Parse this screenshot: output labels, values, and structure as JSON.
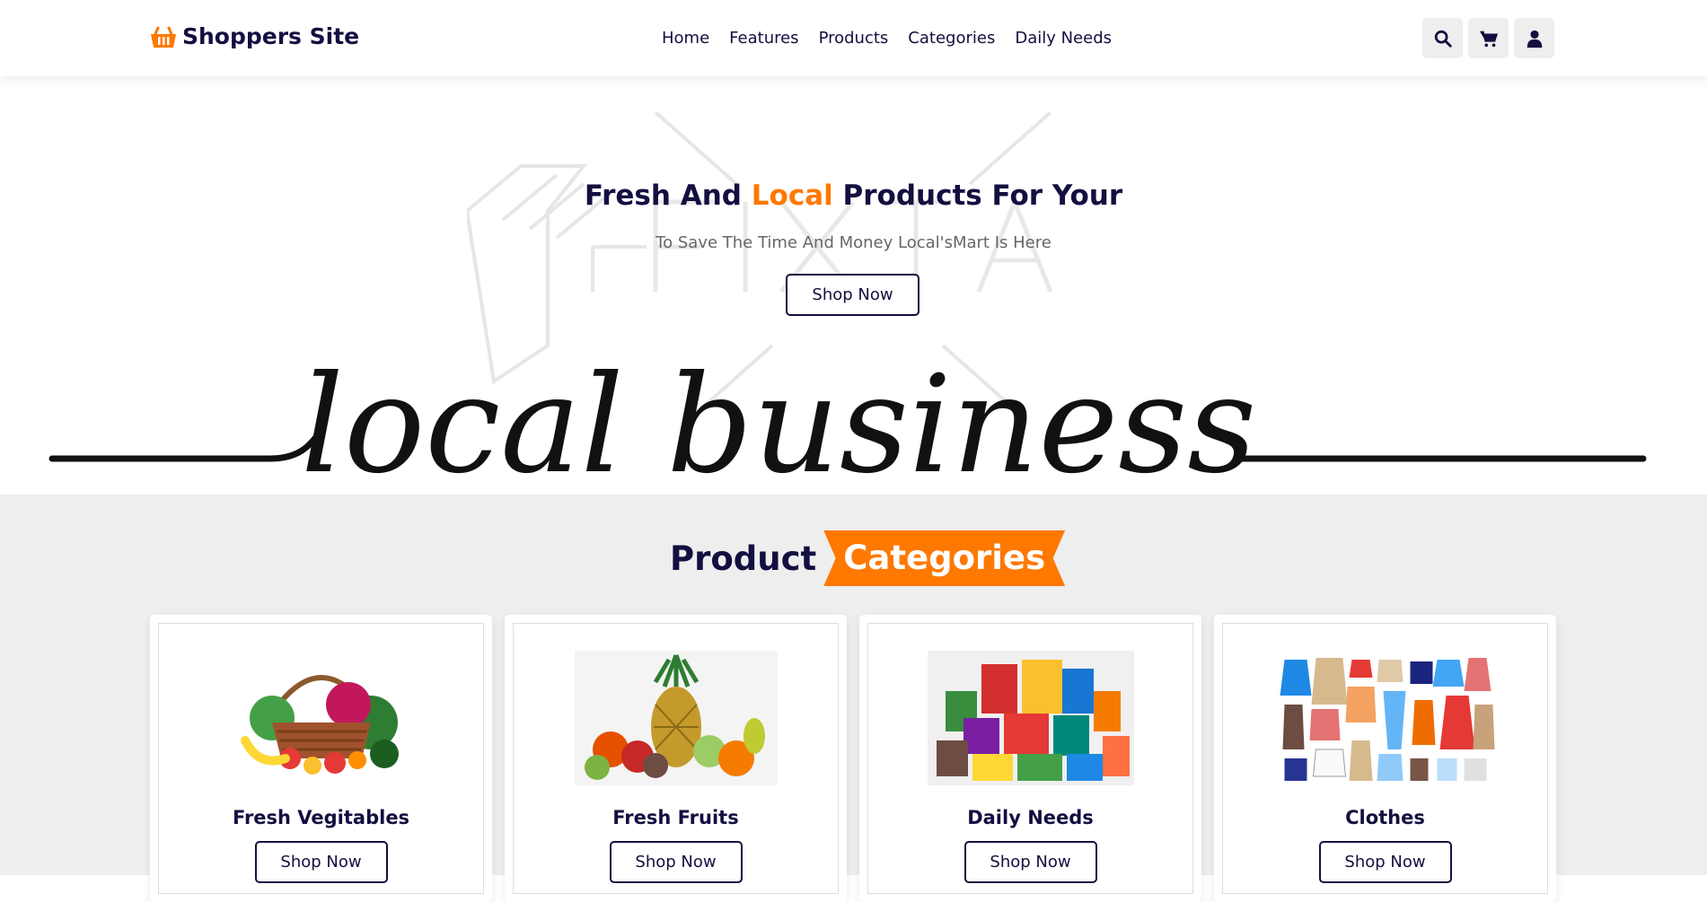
{
  "header": {
    "logo_text": "Shoppers Site",
    "nav": [
      "Home",
      "Features",
      "Products",
      "Categories",
      "Daily Needs"
    ],
    "icons": [
      "search-icon",
      "cart-icon",
      "user-icon"
    ]
  },
  "hero": {
    "title_start": "Fresh And ",
    "title_accent": "Local",
    "title_end": " Products For Your",
    "subtitle": "To Save The Time And Money Local'sMart Is Here",
    "button": "Shop Now",
    "script_text": "local business"
  },
  "categories": {
    "heading_plain": "Product",
    "heading_badge": "Categories",
    "items": [
      {
        "title": "Fresh Vegitables",
        "button": "Shop Now"
      },
      {
        "title": "Fresh Fruits",
        "button": "Shop Now"
      },
      {
        "title": "Daily Needs",
        "button": "Shop Now"
      },
      {
        "title": "Clothes",
        "button": "Shop Now"
      }
    ]
  },
  "colors": {
    "accent": "#ff7800",
    "dark": "#130f40",
    "bg": "#eeeeee"
  }
}
